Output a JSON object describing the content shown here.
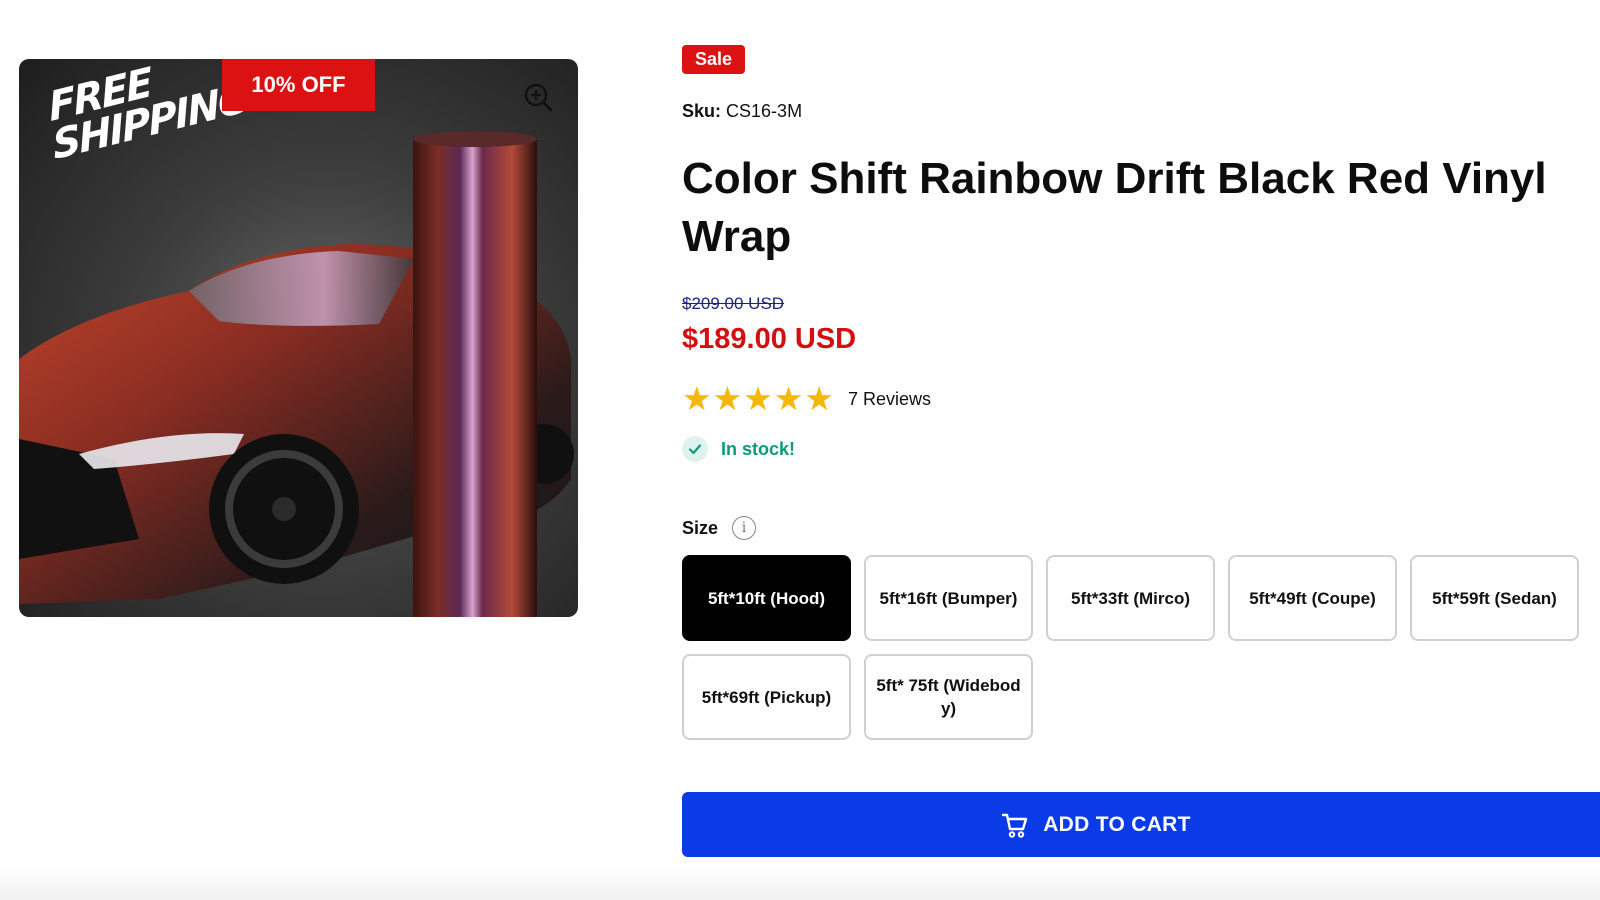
{
  "gallery": {
    "promo_line1": "FREE",
    "promo_line2": "SHIPPING",
    "discount_badge": "10% OFF",
    "zoom_icon": "zoom-in-icon"
  },
  "product": {
    "sale_badge": "Sale",
    "sku_label": "Sku:",
    "sku_value": "CS16-3M",
    "title": "Color Shift Rainbow Drift Black Red Vinyl Wrap",
    "compare_price": "$209.00 USD",
    "price": "$189.00 USD",
    "rating": {
      "stars": 5,
      "max": 5,
      "reviews_text": "7 Reviews"
    },
    "stock_text": "In stock!"
  },
  "size": {
    "label": "Size",
    "info_icon": "info-icon",
    "options": [
      "5ft*10ft (Hood)",
      "5ft*16ft (Bumper)",
      "5ft*33ft (Mirco)",
      "5ft*49ft (Coupe)",
      "5ft*59ft (Sedan)",
      "5ft*69ft (Pickup)",
      "5ft* 75ft (Widebody)"
    ],
    "selected": "5ft*10ft (Hood)"
  },
  "cart": {
    "button_label": "ADD TO CART",
    "icon": "cart-icon"
  },
  "colors": {
    "sale_red": "#dc1111",
    "price_red": "#d30f0f",
    "stock_green": "#0a9a7c",
    "star_gold": "#f5b800",
    "cart_blue": "#0b3be6"
  }
}
